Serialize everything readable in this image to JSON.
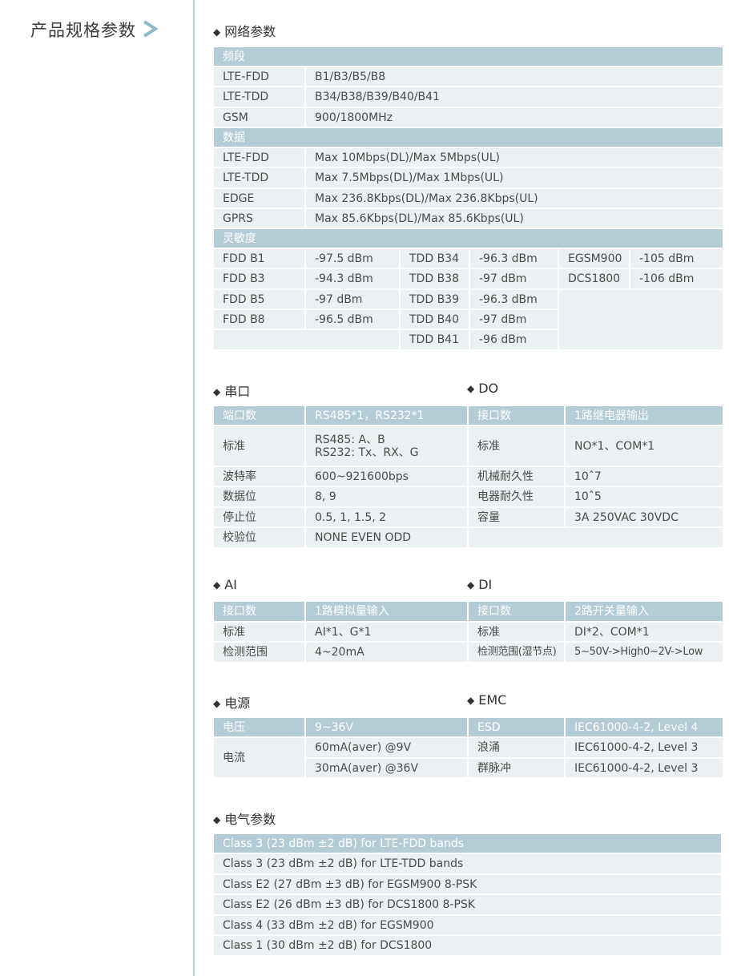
{
  "side": {
    "title": "产品规格参数",
    "arrow": "arrow-right-icon"
  },
  "network": {
    "heading": "网络参数",
    "band": {
      "header": "频段",
      "rows": [
        [
          "LTE-FDD",
          "B1/B3/B5/B8"
        ],
        [
          "LTE-TDD",
          "B34/B38/B39/B40/B41"
        ],
        [
          "GSM",
          "900/1800MHz"
        ]
      ]
    },
    "data": {
      "header": "数据",
      "rows": [
        [
          "LTE-FDD",
          "Max 10Mbps(DL)/Max 5Mbps(UL)"
        ],
        [
          "LTE-TDD",
          "Max 7.5Mbps(DL)/Max 1Mbps(UL)"
        ],
        [
          "EDGE",
          "Max 236.8Kbps(DL)/Max 236.8Kbps(UL)"
        ],
        [
          "GPRS",
          "Max 85.6Kbps(DL)/Max 85.6Kbps(UL)"
        ]
      ]
    },
    "sensitivity": {
      "header": "灵敏度",
      "rows": [
        [
          "FDD B1",
          "-97.5 dBm",
          "TDD B34",
          "-96.3 dBm",
          "EGSM900",
          "-105 dBm"
        ],
        [
          "FDD B3",
          "-94.3 dBm",
          "TDD B38",
          "-97 dBm",
          "DCS1800",
          "-106 dBm"
        ],
        [
          "FDD B5",
          "-97 dBm",
          "TDD B39",
          "-96.3 dBm",
          "",
          ""
        ],
        [
          "FDD B8",
          "-96.5 dBm",
          "TDD B40",
          "-97 dBm",
          "",
          ""
        ],
        [
          "",
          "",
          "TDD B41",
          "-96 dBm",
          "",
          ""
        ]
      ]
    }
  },
  "serial": {
    "heading": "串口",
    "header": [
      "端口数",
      "RS485*1，RS232*1"
    ],
    "standard_label": "标准",
    "standard_lines": [
      "RS485: A、B",
      "RS232: Tx、RX、G"
    ],
    "rows": [
      [
        "波特率",
        "600~921600bps"
      ],
      [
        "数据位",
        "8, 9"
      ],
      [
        "停止位",
        "0.5, 1, 1.5, 2"
      ],
      [
        "校验位",
        "NONE EVEN ODD"
      ]
    ]
  },
  "do": {
    "heading": "DO",
    "header": [
      "接口数",
      "1路继电器输出"
    ],
    "rows": [
      [
        "标准",
        "NO*1、COM*1"
      ],
      [
        "机械耐久性",
        "10ˆ7"
      ],
      [
        "电器耐久性",
        "10ˆ5"
      ],
      [
        "容量",
        "3A  250VAC 30VDC"
      ],
      [
        "",
        ""
      ]
    ]
  },
  "ai": {
    "heading": "AI",
    "header": [
      "接口数",
      "1路模拟量输入"
    ],
    "rows": [
      [
        "标准",
        "AI*1、G*1"
      ],
      [
        "检测范围",
        "4~20mA"
      ]
    ]
  },
  "di": {
    "heading": "DI",
    "header": [
      "接口数",
      "2路开关量输入"
    ],
    "rows": [
      [
        "标准",
        "DI*2、COM*1"
      ],
      [
        "检测范围(湿节点)",
        "5~50V->High0~2V->Low"
      ]
    ]
  },
  "power": {
    "heading": "电源",
    "header": [
      "电压",
      "9~36V"
    ],
    "current_label": "电流",
    "current_values": [
      "60mA(aver) @9V",
      "30mA(aver) @36V"
    ]
  },
  "emc": {
    "heading": "EMC",
    "header": [
      "ESD",
      "IEC61000-4-2, Level 4"
    ],
    "rows": [
      [
        "浪涌",
        "IEC61000-4-2, Level 3"
      ],
      [
        "群脉冲",
        "IEC61000-4-2, Level 3"
      ]
    ]
  },
  "electrical": {
    "heading": "电气参数",
    "header": "Class 3 (23 dBm  ±2 dB) for LTE-FDD bands",
    "rows": [
      "Class 3 (23 dBm  ±2 dB) for LTE-TDD bands",
      "Class E2 (27 dBm  ±3 dB) for EGSM900 8-PSK",
      "Class E2 (26 dBm  ±3 dB) for DCS1800 8-PSK",
      "Class 4 (33 dBm  ±2 dB) for EGSM900",
      "Class 1 (30 dBm  ±2 dB) for DCS1800"
    ]
  },
  "colors": {
    "header": "#b3ccd5",
    "cell": "#ebf1f2",
    "divider": "#b7d1d9",
    "arrow": "#8fb7c4"
  }
}
